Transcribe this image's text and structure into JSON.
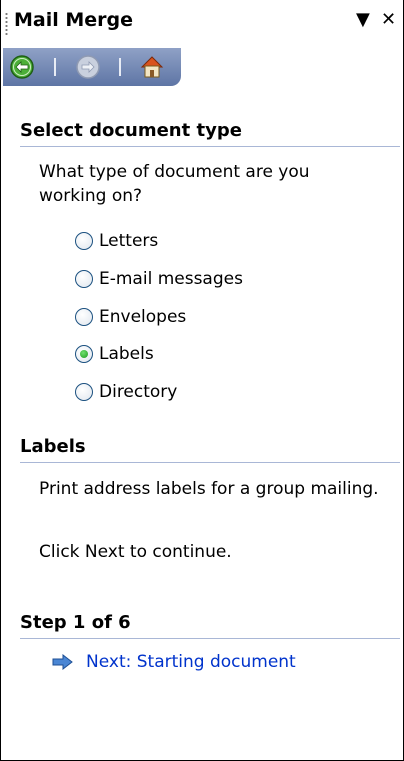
{
  "panel": {
    "title": "Mail Merge",
    "menu_glyph": "▼",
    "close_glyph": "✕"
  },
  "nav": {
    "back_icon": "back-arrow-icon",
    "forward_icon": "forward-arrow-icon",
    "home_icon": "home-icon"
  },
  "section_doc_type": {
    "heading": "Select document type",
    "question": "What type of document are you working on?",
    "options": [
      {
        "label": "Letters",
        "checked": false
      },
      {
        "label": "E-mail messages",
        "checked": false
      },
      {
        "label": "Envelopes",
        "checked": false
      },
      {
        "label": "Labels",
        "checked": true
      },
      {
        "label": "Directory",
        "checked": false
      }
    ]
  },
  "section_labels": {
    "heading": "Labels",
    "description": "Print address labels for a group mailing.",
    "instruction": "Click Next to continue."
  },
  "section_step": {
    "heading": "Step 1 of 6",
    "next_link": "Next: Starting document",
    "next_icon": "right-arrow-icon"
  },
  "colors": {
    "header_rule": "#a9b7d6",
    "link": "#0033cc",
    "nav_bar": "#6f84b1"
  }
}
